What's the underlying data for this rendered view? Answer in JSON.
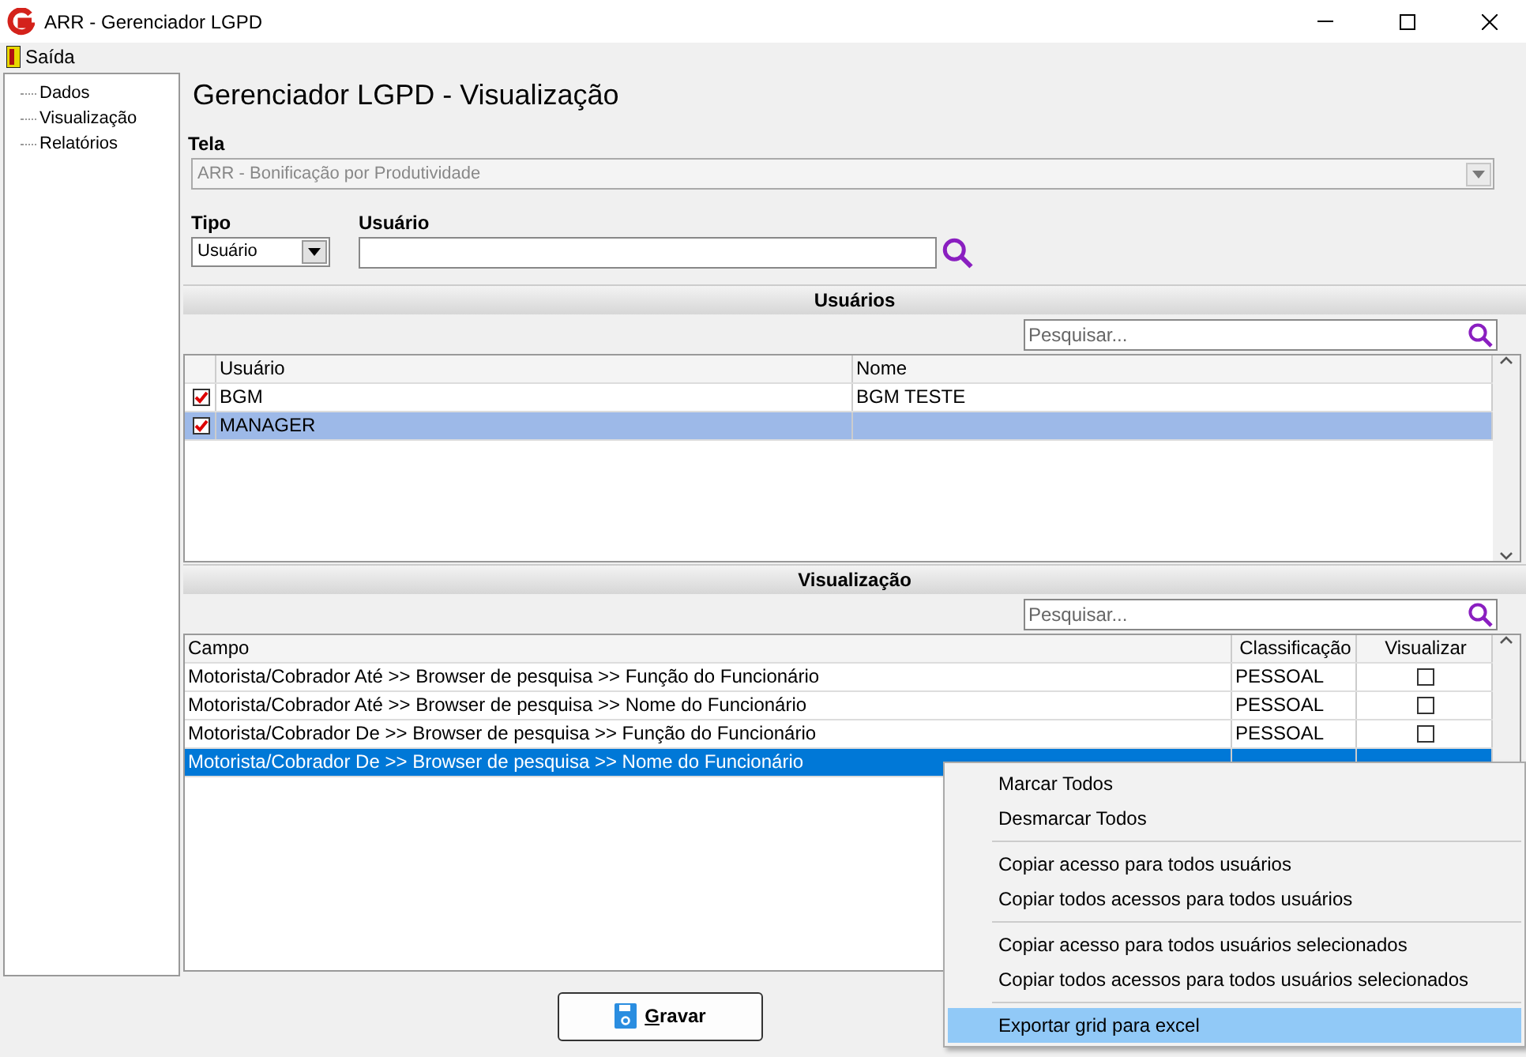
{
  "window": {
    "title": "ARR - Gerenciador LGPD"
  },
  "menu": [
    {
      "label": "Saída"
    }
  ],
  "tree": [
    {
      "label": "Dados"
    },
    {
      "label": "Visualização"
    },
    {
      "label": "Relatórios"
    }
  ],
  "heading": "Gerenciador LGPD - Visualização",
  "tela": {
    "label": "Tela",
    "value": "ARR - Bonificação por Produtividade",
    "disabled": true
  },
  "tipo": {
    "label": "Tipo",
    "value": "Usuário"
  },
  "usuario": {
    "label": "Usuário"
  },
  "usuarios_section": {
    "title": "Usuários",
    "search_placeholder": "Pesquisar...",
    "columns": [
      "Usuário",
      "Nome"
    ],
    "rows": [
      {
        "checked": true,
        "usuario": "BGM",
        "nome": "BGM TESTE",
        "selected": false
      },
      {
        "checked": true,
        "usuario": "MANAGER",
        "selected": true
      }
    ]
  },
  "visualizacao_section": {
    "title": "Visualização",
    "search_placeholder": "Pesquisar...",
    "columns": [
      "Campo",
      "Classificação",
      "Visualizar"
    ],
    "rows": [
      {
        "campo": "Motorista/Cobrador Até >> Browser de pesquisa >> Função do Funcionário",
        "classificacao": "PESSOAL",
        "checked": false,
        "selected": false
      },
      {
        "campo": "Motorista/Cobrador Até >> Browser de pesquisa >> Nome do Funcionário",
        "classificacao": "PESSOAL",
        "checked": false,
        "selected": false
      },
      {
        "campo": "Motorista/Cobrador De >> Browser de pesquisa >> Função do Funcionário",
        "classificacao": "PESSOAL",
        "checked": false,
        "selected": false
      },
      {
        "campo": "Motorista/Cobrador De >> Browser de pesquisa >> Nome do Funcionário",
        "selected": true
      }
    ]
  },
  "save_button": "Gravar",
  "context_menu": [
    {
      "label": "Marcar Todos",
      "separator_before": false,
      "selected": false
    },
    {
      "label": "Desmarcar Todos",
      "separator_before": false,
      "selected": false
    },
    {
      "label": "Copiar acesso para todos usuários",
      "separator_before": true,
      "selected": false
    },
    {
      "label": "Copiar todos acessos para todos usuários",
      "separator_before": false,
      "selected": false
    },
    {
      "label": "Copiar acesso para todos usuários selecionados",
      "separator_before": true,
      "selected": false
    },
    {
      "label": "Copiar todos acessos para todos usuários selecionados",
      "separator_before": false,
      "selected": false
    },
    {
      "label": "Exportar grid para excel",
      "separator_before": true,
      "selected": true
    }
  ]
}
